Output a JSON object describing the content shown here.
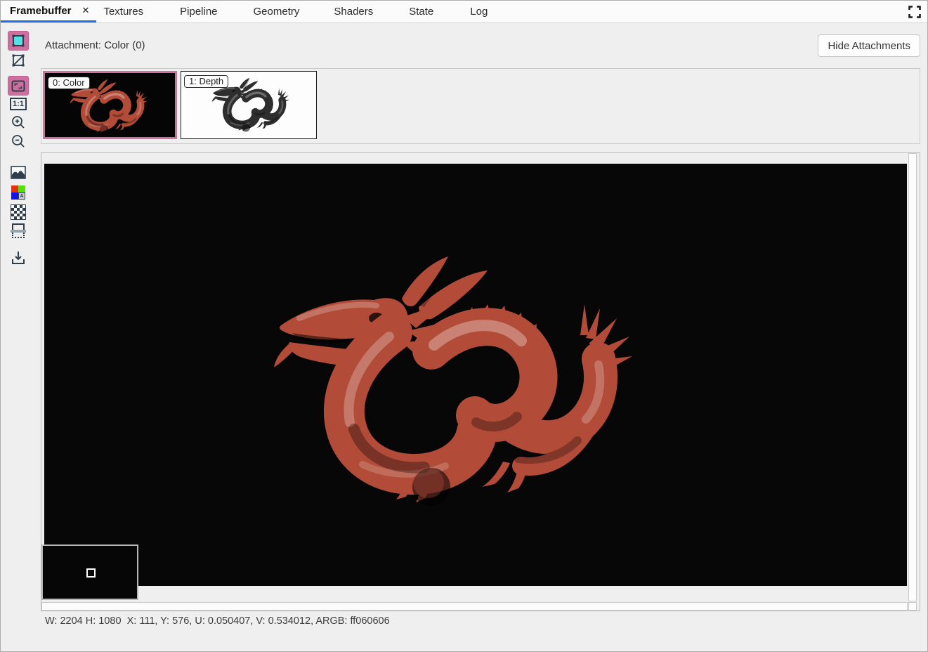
{
  "tabbar": {
    "tabs": [
      {
        "label": "Framebuffer",
        "active": true,
        "closable": true
      },
      {
        "label": "Textures",
        "active": false
      },
      {
        "label": "Pipeline",
        "active": false
      },
      {
        "label": "Geometry",
        "active": false
      },
      {
        "label": "Shaders",
        "active": false
      },
      {
        "label": "State",
        "active": false
      },
      {
        "label": "Log",
        "active": false
      }
    ],
    "close_icon": "✕",
    "fullscreen_icon": "fullscreen-corners-icon"
  },
  "attachment_bar": {
    "label": "Attachment: Color (0)",
    "hide_attachments_button": "Hide Attachments"
  },
  "thumbnails": {
    "items": [
      {
        "label": "0: Color",
        "selected": true,
        "preview": "red dragon on black"
      },
      {
        "label": "1: Depth",
        "selected": false,
        "preview": "dark dragon on white"
      }
    ]
  },
  "toolbar": {
    "one_to_one_label": "1:1",
    "rgba_a_label": "A",
    "items": [
      {
        "name": "texture-display",
        "icon": "filled-square-icon",
        "active": true
      },
      {
        "name": "wireframe",
        "icon": "wireframe-square-icon",
        "active": false
      },
      {
        "name": "fit-to-window",
        "icon": "fit-corners-icon",
        "active": true
      },
      {
        "name": "zoom-one-to-one",
        "icon": "one-to-one-icon",
        "active": false
      },
      {
        "name": "zoom-in",
        "icon": "zoom-in-icon",
        "active": false
      },
      {
        "name": "zoom-out",
        "icon": "zoom-out-icon",
        "active": false
      },
      {
        "name": "image-background",
        "icon": "image-icon",
        "active": false
      },
      {
        "name": "rgba-channels",
        "icon": "rgba-swatch-icon",
        "active": false
      },
      {
        "name": "checkerboard-background",
        "icon": "checkerboard-icon",
        "active": false
      },
      {
        "name": "range-adapt",
        "icon": "range-icon",
        "active": false
      },
      {
        "name": "save-image",
        "icon": "save-icon",
        "active": false
      }
    ]
  },
  "viewport": {
    "pixel_context_visible": true
  },
  "statusbar": {
    "text": "W: 2204 H: 1080  X: 111, Y: 576, U: 0.050407, V: 0.534012, ARGB: ff060606"
  },
  "colors": {
    "accent_pink": "#cf6fa0",
    "tab_underline_blue": "#1e6fe3",
    "toolbar_icon": "#2e3d49",
    "cyan_swatch": "#55e0e6",
    "viewport_bg": "#070707",
    "dragon_red": "#b24c38",
    "depth_gray": "#2e2e2e",
    "window_bg": "#efefef"
  }
}
